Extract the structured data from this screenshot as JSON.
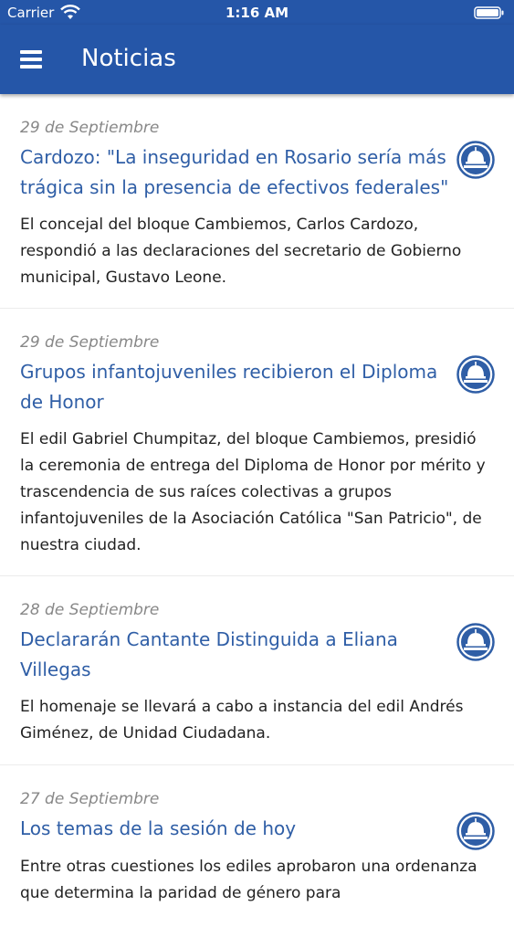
{
  "status_bar": {
    "carrier": "Carrier",
    "time": "1:16 AM"
  },
  "header": {
    "title": "Noticias",
    "menu_icon": "hamburger-menu-icon"
  },
  "colors": {
    "header_bg": "#2556a8",
    "title_text": "#2f5ea6",
    "date_text": "#888888",
    "body_text": "#222222"
  },
  "news": [
    {
      "date": "29 de Septiembre",
      "title": "Cardozo: \"La inseguridad en Rosario sería más trágica sin la presencia de efectivos federales\"",
      "summary": "El concejal del bloque Cambiemos, Carlos Cardozo, respondió a las declaraciones del secretario de Gobierno municipal, Gustavo  Leone.",
      "icon": "legislature-dome-icon"
    },
    {
      "date": "29 de Septiembre",
      "title": "Grupos infantojuveniles recibieron el Diploma de Honor",
      "summary": "El edil Gabriel Chumpitaz, del bloque Cambiemos, presidió la ceremonia de entrega del Diploma de Honor por mérito y trascendencia  de sus raíces colectivas  a grupos infantojuveniles de la Asociación Católica \"San Patricio\",  de nuestra ciudad.",
      "icon": "legislature-dome-icon"
    },
    {
      "date": "28 de Septiembre",
      "title": "Declararán Cantante Distinguida a Eliana Villegas",
      "summary": "El homenaje se llevará a cabo a instancia del edil Andrés Giménez, de Unidad Ciudadana.",
      "icon": "legislature-dome-icon"
    },
    {
      "date": "27 de Septiembre",
      "title": "Los temas de la sesión de hoy",
      "summary": "Entre otras cuestiones los ediles aprobaron una ordenanza que determina la paridad de género para",
      "icon": "legislature-dome-icon"
    }
  ]
}
